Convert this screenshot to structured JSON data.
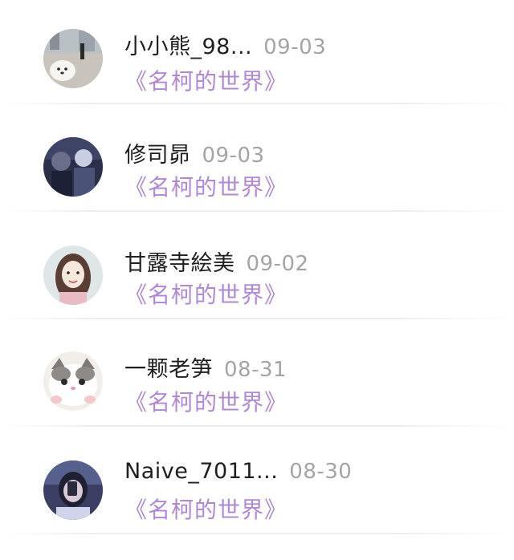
{
  "items": [
    {
      "name": "小小熊_98...",
      "date": "09-03",
      "work": "《名柯的世界》",
      "avatar_icon": "avatar-dog-street"
    },
    {
      "name": "修司昴",
      "date": "09-03",
      "work": "《名柯的世界》",
      "avatar_icon": "avatar-dark-photo"
    },
    {
      "name": "甘露寺絵美",
      "date": "09-02",
      "work": "《名柯的世界》",
      "avatar_icon": "avatar-girl-drawing"
    },
    {
      "name": "一颗老笋",
      "date": "08-31",
      "work": "《名柯的世界》",
      "avatar_icon": "avatar-cat"
    },
    {
      "name": "Naive_7011...",
      "date": "08-30",
      "work": "《名柯的世界》",
      "avatar_icon": "avatar-mirror-selfie"
    }
  ],
  "colors": {
    "name": "#1f1f1f",
    "date": "#a4a4a4",
    "work_link": "#b087d6",
    "divider": "#ececec"
  }
}
